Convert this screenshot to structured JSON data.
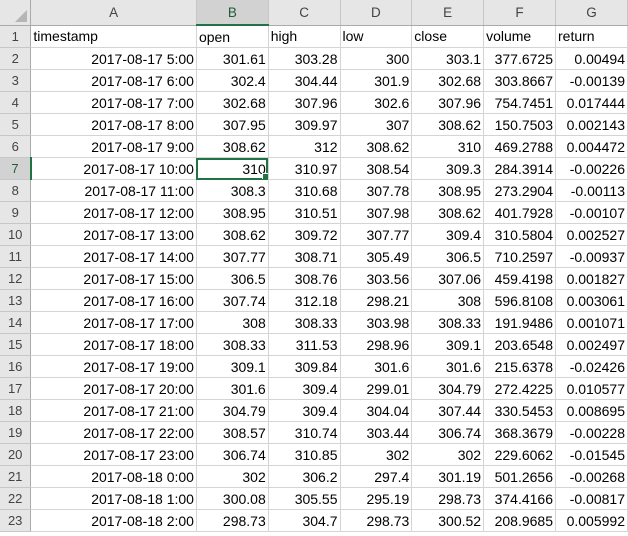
{
  "spreadsheet": {
    "selected_cell": "B7",
    "column_letters": [
      "A",
      "B",
      "C",
      "D",
      "E",
      "F",
      "G"
    ],
    "headers": [
      "timestamp",
      "open",
      "high",
      "low",
      "close",
      "volume",
      "return"
    ],
    "rows": [
      [
        "2017-08-17 5:00",
        "301.61",
        "303.28",
        "300",
        "303.1",
        "377.6725",
        "0.00494"
      ],
      [
        "2017-08-17 6:00",
        "302.4",
        "304.44",
        "301.9",
        "302.68",
        "303.8667",
        "-0.00139"
      ],
      [
        "2017-08-17 7:00",
        "302.68",
        "307.96",
        "302.6",
        "307.96",
        "754.7451",
        "0.017444"
      ],
      [
        "2017-08-17 8:00",
        "307.95",
        "309.97",
        "307",
        "308.62",
        "150.7503",
        "0.002143"
      ],
      [
        "2017-08-17 9:00",
        "308.62",
        "312",
        "308.62",
        "310",
        "469.2788",
        "0.004472"
      ],
      [
        "2017-08-17 10:00",
        "310",
        "310.97",
        "308.54",
        "309.3",
        "284.3914",
        "-0.00226"
      ],
      [
        "2017-08-17 11:00",
        "308.3",
        "310.68",
        "307.78",
        "308.95",
        "273.2904",
        "-0.00113"
      ],
      [
        "2017-08-17 12:00",
        "308.95",
        "310.51",
        "307.98",
        "308.62",
        "401.7928",
        "-0.00107"
      ],
      [
        "2017-08-17 13:00",
        "308.62",
        "309.72",
        "307.77",
        "309.4",
        "310.5804",
        "0.002527"
      ],
      [
        "2017-08-17 14:00",
        "307.77",
        "308.71",
        "305.49",
        "306.5",
        "710.2597",
        "-0.00937"
      ],
      [
        "2017-08-17 15:00",
        "306.5",
        "308.76",
        "303.56",
        "307.06",
        "459.4198",
        "0.001827"
      ],
      [
        "2017-08-17 16:00",
        "307.74",
        "312.18",
        "298.21",
        "308",
        "596.8108",
        "0.003061"
      ],
      [
        "2017-08-17 17:00",
        "308",
        "308.33",
        "303.98",
        "308.33",
        "191.9486",
        "0.001071"
      ],
      [
        "2017-08-17 18:00",
        "308.33",
        "311.53",
        "298.96",
        "309.1",
        "203.6548",
        "0.002497"
      ],
      [
        "2017-08-17 19:00",
        "309.1",
        "309.84",
        "301.6",
        "301.6",
        "215.6378",
        "-0.02426"
      ],
      [
        "2017-08-17 20:00",
        "301.6",
        "309.4",
        "299.01",
        "304.79",
        "272.4225",
        "0.010577"
      ],
      [
        "2017-08-17 21:00",
        "304.79",
        "309.4",
        "304.04",
        "307.44",
        "330.5453",
        "0.008695"
      ],
      [
        "2017-08-17 22:00",
        "308.57",
        "310.74",
        "303.44",
        "306.74",
        "368.3679",
        "-0.00228"
      ],
      [
        "2017-08-17 23:00",
        "306.74",
        "310.85",
        "302",
        "302",
        "229.6062",
        "-0.01545"
      ],
      [
        "2017-08-18 0:00",
        "302",
        "306.2",
        "297.4",
        "301.19",
        "501.2656",
        "-0.00268"
      ],
      [
        "2017-08-18 1:00",
        "300.08",
        "305.55",
        "295.19",
        "298.73",
        "374.4166",
        "-0.00817"
      ],
      [
        "2017-08-18 2:00",
        "298.73",
        "304.7",
        "298.73",
        "300.52",
        "208.9685",
        "0.005992"
      ]
    ]
  }
}
